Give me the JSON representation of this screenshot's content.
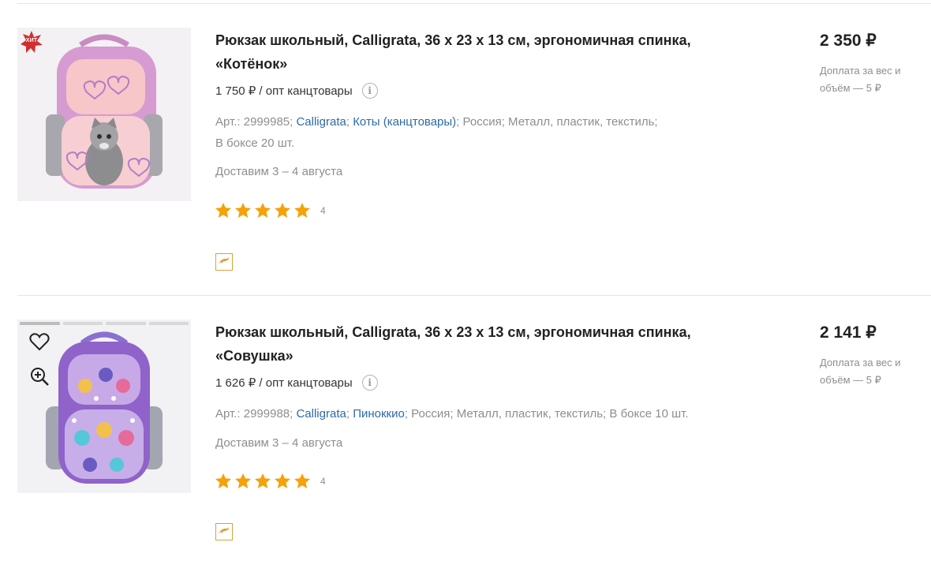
{
  "products": [
    {
      "title": "Рюкзак школьный, Calligrata, 36 х 23 х 13 см, эргономичная спинка, «Котёнок»",
      "wholesale": "1 750 ₽ / опт канцтовары",
      "info_icon": "info-icon",
      "article": "Арт.: 2999985;",
      "brand": "Calligrata",
      "category": "Коты (канцтовары)",
      "country": "Россия;",
      "material": "Металл, пластик, текстиль;",
      "box": "В боксе 20 шт.",
      "delivery": "Доставим 3 – 4 августа",
      "rating_count": "4",
      "price": "2 350 ₽",
      "extra_note": "Доплата за вес и объём — 5 ₽",
      "badge": "ХИТ"
    },
    {
      "title": "Рюкзак школьный, Calligrata, 36 х 23 х 13 см, эргономичная спинка, «Совушка»",
      "wholesale": "1 626 ₽ / опт канцтовары",
      "info_icon": "info-icon",
      "article": "Арт.: 2999988;",
      "brand": "Calligrata",
      "category": "Пиноккио",
      "country": "Россия;",
      "material": "Металл, пластик, текстиль;",
      "box": "В боксе 10 шт.",
      "delivery": "Доставим 3 – 4 августа",
      "rating_count": "4",
      "price": "2 141 ₽",
      "extra_note": "Доплата за вес и объём — 5 ₽"
    }
  ],
  "colors": {
    "link": "#2d6ba8",
    "star": "#f5a10a",
    "badge": "#d22e2e",
    "dolphin_border": "#d9a23a"
  }
}
